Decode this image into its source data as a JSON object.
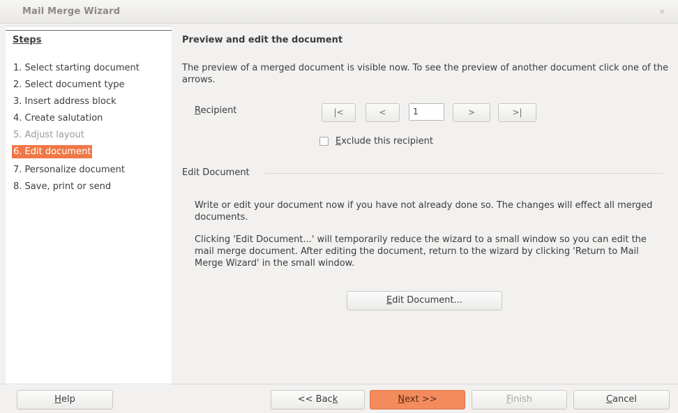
{
  "window": {
    "title": "Mail Merge Wizard",
    "close_glyph": "×"
  },
  "sidebar": {
    "heading": "Steps",
    "items": [
      {
        "label": "1. Select starting document",
        "state": "normal"
      },
      {
        "label": "2. Select document type",
        "state": "normal"
      },
      {
        "label": "3. Insert address block",
        "state": "normal"
      },
      {
        "label": "4. Create salutation",
        "state": "normal"
      },
      {
        "label": "5. Adjust layout",
        "state": "disabled"
      },
      {
        "label": "6. Edit document",
        "state": "active"
      },
      {
        "label": "7. Personalize document",
        "state": "normal"
      },
      {
        "label": "8. Save, print or send",
        "state": "normal"
      }
    ],
    "active_color": "#f07746"
  },
  "main": {
    "title": "Preview and edit the document",
    "intro": "The preview of a merged document is visible now. To see the preview of another document click one of the arrows.",
    "recipient": {
      "label_accel": "R",
      "label_rest": "ecipient",
      "first": "|<",
      "prev": "<",
      "value": "1",
      "next": ">",
      "last": ">|"
    },
    "exclude": {
      "accel": "E",
      "rest": "xclude this recipient",
      "checked": false
    },
    "edit_section": {
      "label": "Edit Document",
      "para1": "Write or edit your document now if you have not already done so. The changes will effect all merged documents.",
      "para2": "Clicking 'Edit Document...' will temporarily reduce the wizard to a small window so you can edit the mail merge document. After editing the document, return to the wizard by clicking 'Return to Mail Merge Wizard' in the small window.",
      "button_accel": "E",
      "button_rest": "dit Document..."
    }
  },
  "footer": {
    "help_accel": "H",
    "help_rest": "elp",
    "back_pre": "<< Bac",
    "back_accel": "k",
    "next_accel": "N",
    "next_rest": "ext >>",
    "finish_accel": "F",
    "finish_rest": "inish",
    "cancel_accel": "C",
    "cancel_rest": "ancel",
    "primary_color": "#f38b5d"
  }
}
